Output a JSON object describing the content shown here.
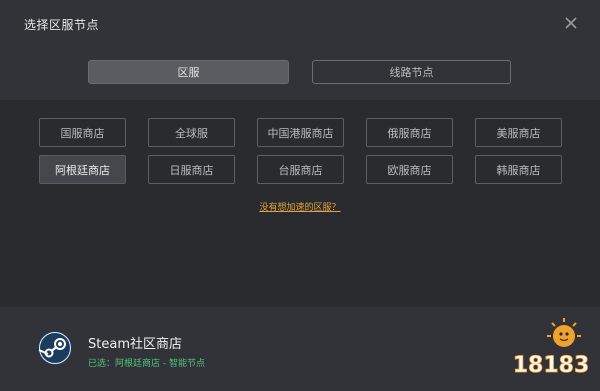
{
  "dialog": {
    "title": "选择区服节点",
    "close_icon": "close-icon"
  },
  "tabs": [
    {
      "label": "区服",
      "active": true
    },
    {
      "label": "线路节点",
      "active": false
    }
  ],
  "regions": [
    {
      "label": "国服商店",
      "selected": false
    },
    {
      "label": "全球服",
      "selected": false
    },
    {
      "label": "中国港服商店",
      "selected": false
    },
    {
      "label": "俄服商店",
      "selected": false
    },
    {
      "label": "美服商店",
      "selected": false
    },
    {
      "label": "阿根廷商店",
      "selected": true
    },
    {
      "label": "日服商店",
      "selected": false
    },
    {
      "label": "台服商店",
      "selected": false
    },
    {
      "label": "欧服商店",
      "selected": false
    },
    {
      "label": "韩服商店",
      "selected": false
    }
  ],
  "suggest_link": "没有想加速的区服？",
  "footer": {
    "game_name": "Steam社区商店",
    "status": "已选：阿根廷商店 - 智能节点",
    "logo_icon": "steam-logo-icon"
  },
  "watermark": {
    "text": "18183"
  },
  "colors": {
    "accent_link": "#e1a23a",
    "status_green": "#4fc37a",
    "selected_bg": "#46474c"
  }
}
